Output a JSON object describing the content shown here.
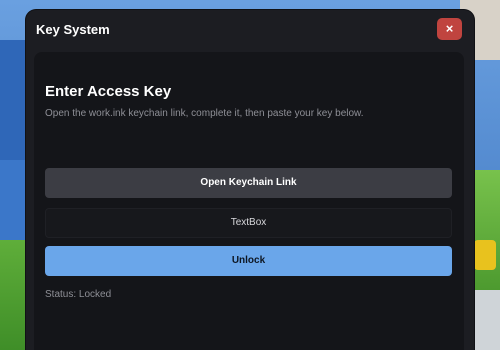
{
  "window": {
    "title": "Key System",
    "close_label": "×"
  },
  "content": {
    "heading": "Enter Access Key",
    "description": "Open the work.ink keychain link, complete it, then paste your key below.",
    "open_button_label": "Open Keychain Link",
    "textbox_text": "TextBox",
    "unlock_button_label": "Unlock",
    "status_text": "Status: Locked"
  },
  "colors": {
    "window_bg": "#1c1d22",
    "panel_bg": "#141519",
    "close_button": "#c0443f",
    "open_button": "#3c3d44",
    "unlock_button": "#6aa6ea"
  }
}
